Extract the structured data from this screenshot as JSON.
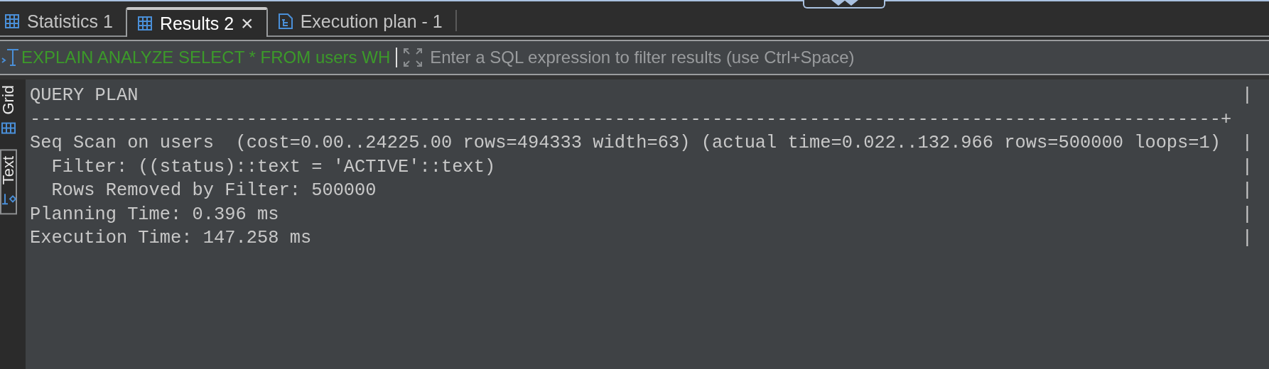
{
  "tabs": [
    {
      "label": "Statistics 1",
      "kind": "grid",
      "selected": false
    },
    {
      "label": "Results 2",
      "kind": "grid",
      "selected": true,
      "close": "×"
    },
    {
      "label": "Execution plan - 1",
      "kind": "plan",
      "selected": false
    }
  ],
  "filter_bar": {
    "query": "EXPLAIN ANALYZE SELECT * FROM users WH",
    "placeholder": "Enter a SQL expression to filter results (use Ctrl+Space)"
  },
  "side_tabs": [
    {
      "label": "Grid",
      "kind": "grid",
      "selected": false
    },
    {
      "label": "Text",
      "kind": "text",
      "selected": true
    }
  ],
  "output": {
    "header": {
      "text": "QUERY PLAN",
      "end": "|"
    },
    "separator": "--------------------------------------------------------------------------------------------------------------+",
    "rows": [
      {
        "text": "Seq Scan on users  (cost=0.00..24225.00 rows=494333 width=63) (actual time=0.022..132.966 rows=500000 loops=1)",
        "end": "|"
      },
      {
        "text": "  Filter: ((status)::text = 'ACTIVE'::text)",
        "end": "|"
      },
      {
        "text": "  Rows Removed by Filter: 500000",
        "end": "|"
      },
      {
        "text": "Planning Time: 0.396 ms",
        "end": "|"
      },
      {
        "text": "Execution Time: 147.258 ms",
        "end": "|"
      }
    ]
  }
}
